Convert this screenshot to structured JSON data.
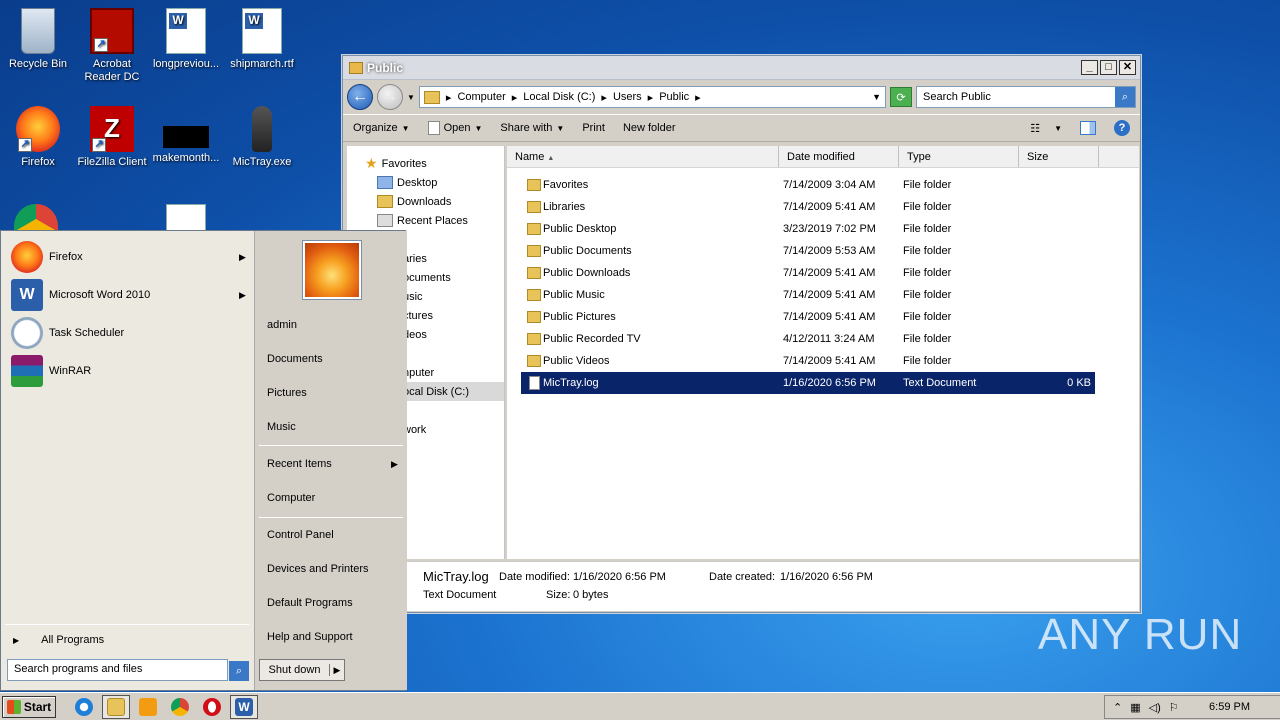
{
  "desktop": {
    "icons": [
      {
        "label": "Recycle Bin",
        "icon": "recycle-bin-icon"
      },
      {
        "label": "Acrobat Reader DC",
        "icon": "acrobat-icon"
      },
      {
        "label": "longpreviou...",
        "icon": "word-doc-icon"
      },
      {
        "label": "shipmarch.rtf",
        "icon": "word-doc-icon"
      },
      {
        "label": "Firefox",
        "icon": "firefox-icon"
      },
      {
        "label": "FileZilla Client",
        "icon": "filezilla-icon"
      },
      {
        "label": "makemonth...",
        "icon": "black-thumbnail-icon"
      },
      {
        "label": "MicTray.exe",
        "icon": "microphone-icon"
      }
    ]
  },
  "explorer": {
    "title": "Public",
    "breadcrumb": [
      "Computer",
      "Local Disk (C:)",
      "Users",
      "Public"
    ],
    "search_placeholder": "Search Public",
    "toolbar": {
      "organize": "Organize",
      "open": "Open",
      "share_with": "Share with",
      "print": "Print",
      "new_folder": "New folder"
    },
    "nav": {
      "favorites": "Favorites",
      "desktop": "Desktop",
      "downloads": "Downloads",
      "recent_places": "Recent Places",
      "libraries": "aries",
      "documents": "ocuments",
      "music": "usic",
      "pictures": "ctures",
      "videos": "deos",
      "computer": "nputer",
      "local_disk": "ocal Disk (C:)",
      "network": "work"
    },
    "columns": {
      "name": "Name",
      "date": "Date modified",
      "type": "Type",
      "size": "Size"
    },
    "files": [
      {
        "name": "Favorites",
        "date": "7/14/2009 3:04 AM",
        "type": "File folder",
        "size": ""
      },
      {
        "name": "Libraries",
        "date": "7/14/2009 5:41 AM",
        "type": "File folder",
        "size": ""
      },
      {
        "name": "Public Desktop",
        "date": "3/23/2019 7:02 PM",
        "type": "File folder",
        "size": ""
      },
      {
        "name": "Public Documents",
        "date": "7/14/2009 5:53 AM",
        "type": "File folder",
        "size": ""
      },
      {
        "name": "Public Downloads",
        "date": "7/14/2009 5:41 AM",
        "type": "File folder",
        "size": ""
      },
      {
        "name": "Public Music",
        "date": "7/14/2009 5:41 AM",
        "type": "File folder",
        "size": ""
      },
      {
        "name": "Public Pictures",
        "date": "7/14/2009 5:41 AM",
        "type": "File folder",
        "size": ""
      },
      {
        "name": "Public Recorded TV",
        "date": "4/12/2011 3:24 AM",
        "type": "File folder",
        "size": ""
      },
      {
        "name": "Public Videos",
        "date": "7/14/2009 5:41 AM",
        "type": "File folder",
        "size": ""
      },
      {
        "name": "MicTray.log",
        "date": "1/16/2020 6:56 PM",
        "type": "Text Document",
        "size": "0 KB"
      }
    ],
    "details": {
      "name": "MicTray.log",
      "type": "Text Document",
      "date_modified_label": "Date modified:",
      "date_modified": "1/16/2020 6:56 PM",
      "date_created_label": "Date created:",
      "date_created": "1/16/2020 6:56 PM",
      "size_label": "Size:",
      "size": "0 bytes"
    }
  },
  "start_menu": {
    "programs": [
      "Firefox",
      "Microsoft Word 2010",
      "Task Scheduler",
      "WinRAR"
    ],
    "all_programs": "All Programs",
    "search_placeholder": "Search programs and files",
    "right": [
      "admin",
      "Documents",
      "Pictures",
      "Music",
      "Recent Items",
      "Computer",
      "Control Panel",
      "Devices and Printers",
      "Default Programs",
      "Help and Support"
    ],
    "shutdown": "Shut down"
  },
  "taskbar": {
    "start": "Start",
    "clock": "6:59 PM"
  },
  "watermark": "ANY RUN",
  "colors": {
    "selection": "#0a246a",
    "desktop": "#1c74d0"
  }
}
